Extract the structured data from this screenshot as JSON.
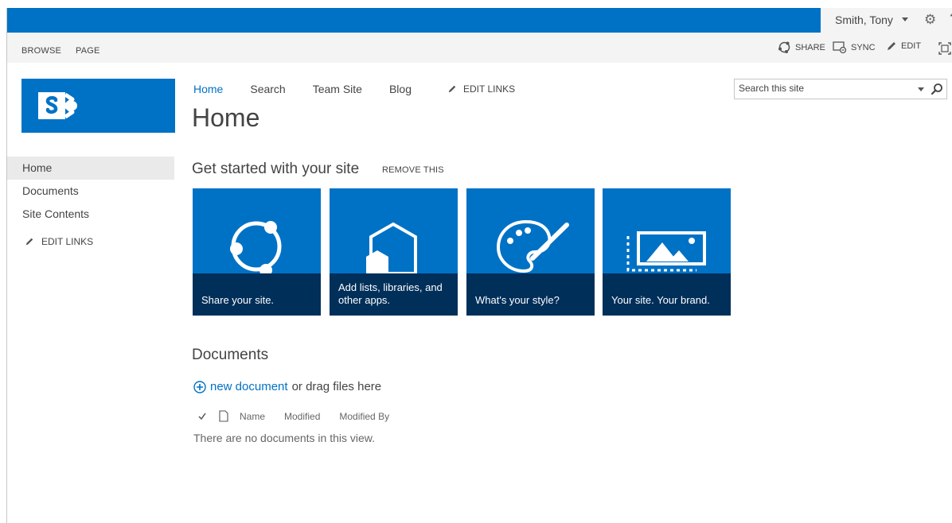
{
  "colors": {
    "accent": "#0072c6",
    "tile_caption_bg": "#002346"
  },
  "suitebar": {
    "user_name": "Smith, Tony",
    "settings_icon": "gear-icon",
    "help_label": "?"
  },
  "ribbon": {
    "tabs": [
      "BROWSE",
      "PAGE"
    ],
    "actions": {
      "share": "SHARE",
      "sync": "SYNC",
      "edit": "EDIT"
    }
  },
  "leftnav": {
    "items": [
      "Home",
      "Documents",
      "Site Contents"
    ],
    "edit_links": "EDIT LINKS"
  },
  "topnav": {
    "items": [
      "Home",
      "Search",
      "Team Site",
      "Blog"
    ],
    "edit_links": "EDIT LINKS"
  },
  "page": {
    "title": "Home"
  },
  "search": {
    "placeholder": "Search this site"
  },
  "get_started": {
    "title": "Get started with your site",
    "remove": "REMOVE THIS",
    "tiles": [
      {
        "caption": "Share your site.",
        "icon": "share-icon"
      },
      {
        "caption": "Add lists, libraries, and other apps.",
        "icon": "apps-icon"
      },
      {
        "caption": "What's your style?",
        "icon": "palette-icon"
      },
      {
        "caption": "Your site. Your brand.",
        "icon": "picture-icon"
      }
    ]
  },
  "documents": {
    "title": "Documents",
    "new_document": "new document",
    "drag_text": "or drag files here",
    "columns": [
      "Name",
      "Modified",
      "Modified By"
    ],
    "empty_message": "There are no documents in this view."
  }
}
